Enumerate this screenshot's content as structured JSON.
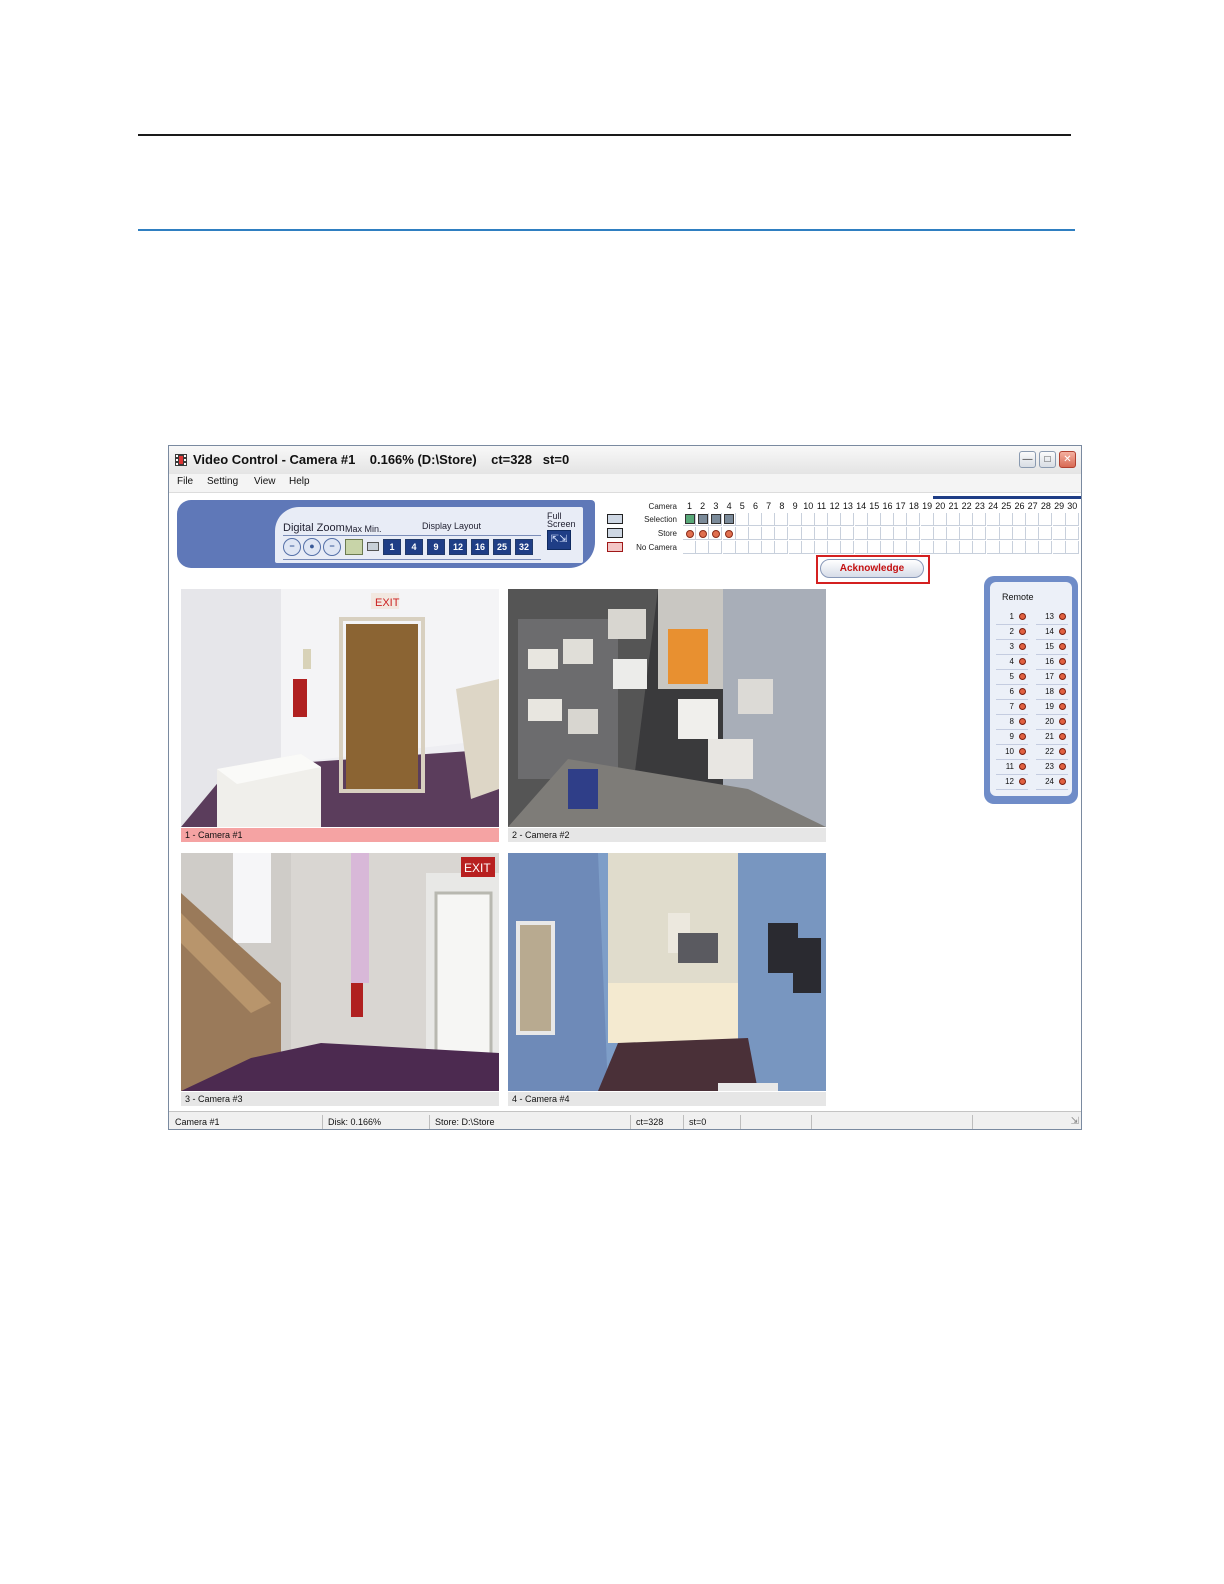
{
  "window": {
    "title": "Video Control - Camera #1    0.166% (D:\\Store)    ct=328   st=0"
  },
  "menu": [
    "File",
    "Setting",
    "View",
    "Help"
  ],
  "controls": {
    "digital_zoom_label": "Digital Zoom",
    "max_min_label": "Max Min.",
    "display_layout_label": "Display Layout",
    "full_screen_label_1": "Full",
    "full_screen_label_2": "Screen",
    "layouts": [
      "1",
      "4",
      "9",
      "12",
      "16",
      "25",
      "32"
    ]
  },
  "camera_grid": {
    "camera_label": "Camera",
    "selection_label": "Selection",
    "store_label": "Store",
    "no_camera_label": "No Camera",
    "numbers": [
      "1",
      "2",
      "3",
      "4",
      "5",
      "6",
      "7",
      "8",
      "9",
      "10",
      "11",
      "12",
      "13",
      "14",
      "15",
      "16",
      "17",
      "18",
      "19",
      "20",
      "21",
      "22",
      "23",
      "24",
      "25",
      "26",
      "27",
      "28",
      "29",
      "30"
    ],
    "selected_count": 4
  },
  "acknowledge_label": "Acknowledge",
  "tiles": [
    {
      "caption": "1 - Camera #1"
    },
    {
      "caption": "2 - Camera #2"
    },
    {
      "caption": "3 - Camera #3"
    },
    {
      "caption": "4 - Camera #4"
    }
  ],
  "remote": {
    "title": "Remote",
    "left": [
      "1",
      "2",
      "3",
      "4",
      "5",
      "6",
      "7",
      "8",
      "9",
      "10",
      "11",
      "12"
    ],
    "right": [
      "13",
      "14",
      "15",
      "16",
      "17",
      "18",
      "19",
      "20",
      "21",
      "22",
      "23",
      "24"
    ]
  },
  "status": {
    "camera": "Camera #1",
    "disk": "Disk:   0.166%",
    "store": "Store: D:\\Store",
    "ct": "ct=328",
    "st": "st=0"
  },
  "colors": {
    "panel_blue": "#5f78b8",
    "acknowledge_border": "#d42020",
    "active_caption": "#f5a3a3"
  }
}
